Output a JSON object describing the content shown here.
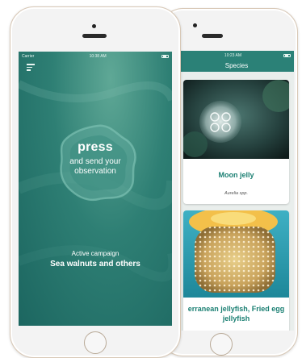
{
  "front": {
    "status_carrier": "Carrier",
    "status_time": "10:38 AM",
    "press_label": "press",
    "send_label": "and send your observation",
    "campaign_label": "Active campaign",
    "campaign_name": "Sea walnuts and others"
  },
  "back": {
    "status_time": "10:23 AM",
    "title": "Species",
    "cards": [
      {
        "name": "Moon jelly",
        "latin": "Aurelia spp."
      },
      {
        "name": "erranean jellyfish, Fried egg jellyfish"
      }
    ]
  },
  "colors": {
    "accent": "#2b8177",
    "card_title": "#1a7f72",
    "phone_frame": "#d8c8b6"
  },
  "icons": [
    "menu-icon",
    "wifi-icon",
    "battery-icon"
  ]
}
